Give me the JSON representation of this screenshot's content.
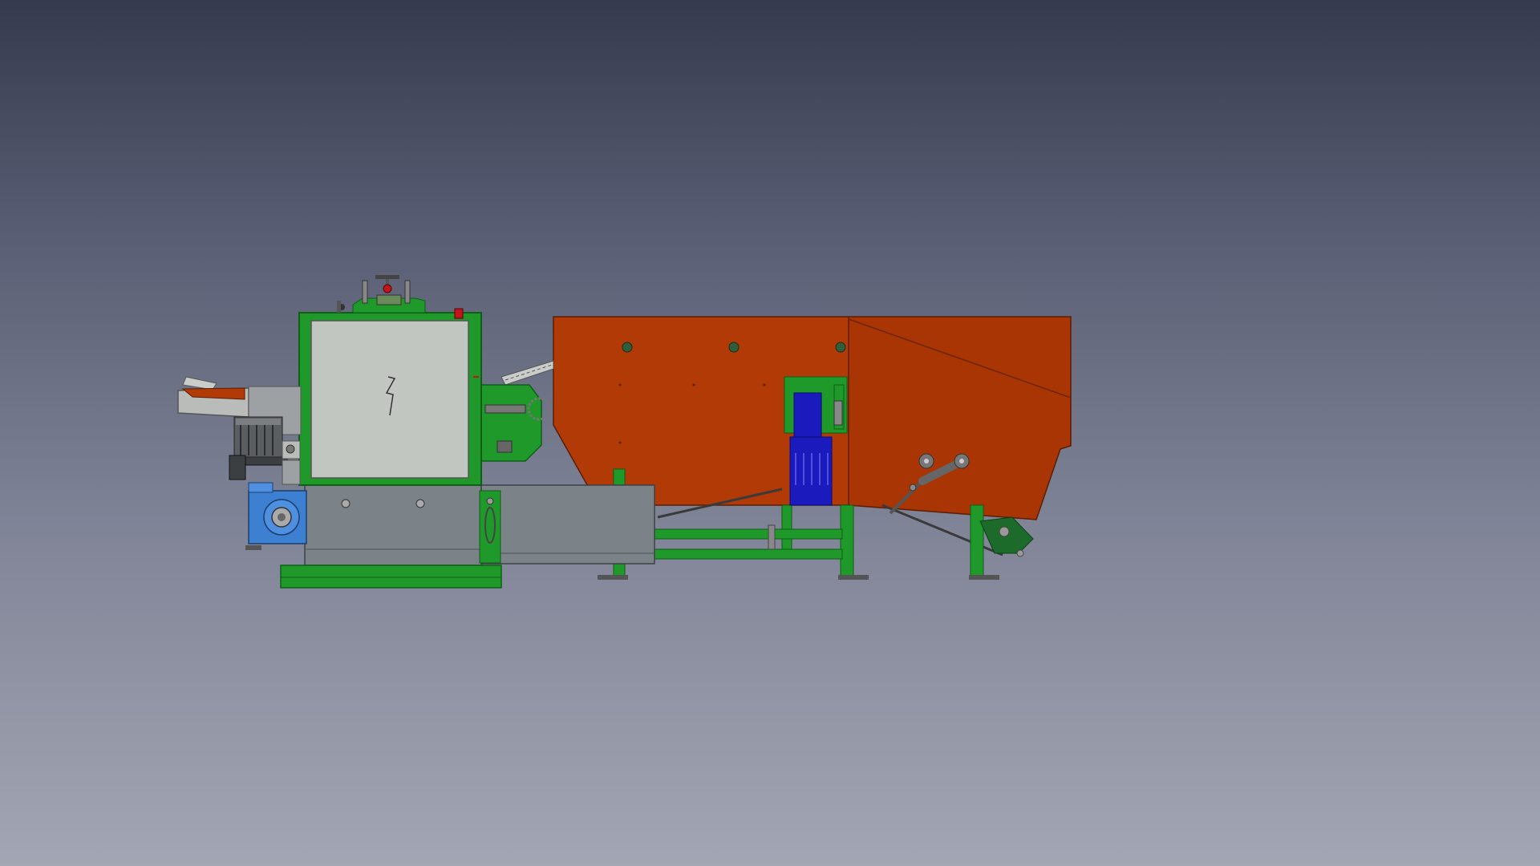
{
  "viewer": {
    "background_top": "#363a4f",
    "background_bottom": "#a3a6b3"
  },
  "model": {
    "colors": {
      "frame_green": "#1f9a2a",
      "frame_green_dark": "#0f5f17",
      "hopper_orange": "#b23a06",
      "hopper_orange_light": "#c74a10",
      "panel_grey": "#b9bcb9",
      "panel_grey_light": "#c9ccc9",
      "base_grey": "#7c8388",
      "motor_blue": "#1b1bbd",
      "gearbox_blue": "#3d7fd1",
      "motor_dark": "#3b3f42",
      "accent_red": "#c3141b"
    },
    "parts": [
      "feed-chute",
      "electric-motor",
      "gearbox",
      "cutter-housing",
      "control-handwheel",
      "base-housing",
      "base-frame",
      "conveyor-chain",
      "side-motor",
      "hopper",
      "hopper-drive-motor",
      "tension-lever",
      "support-legs",
      "rear-bracket"
    ]
  }
}
